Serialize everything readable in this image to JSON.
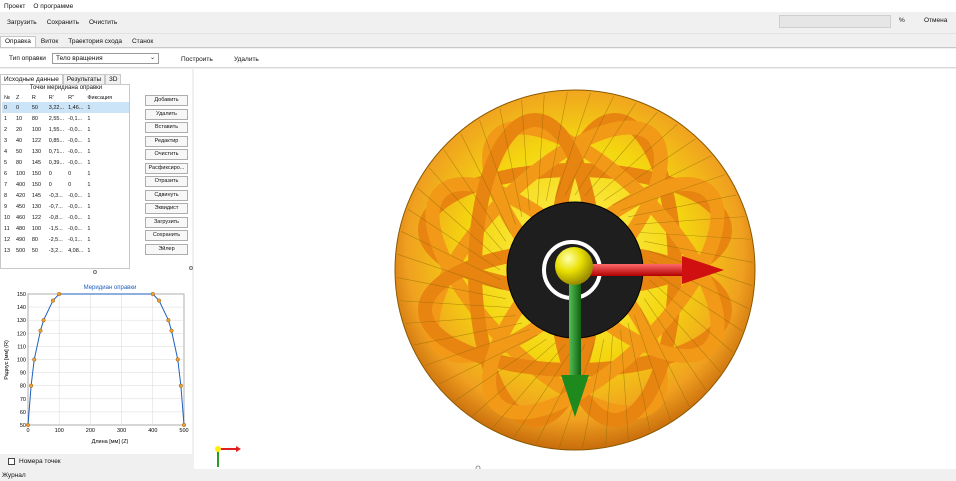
{
  "menu": [
    "Проект",
    "О программе"
  ],
  "toolbar": {
    "load": "Загрузить",
    "save": "Сохранить",
    "clear": "Очистить",
    "percent": "%",
    "cancel": "Отмена"
  },
  "main_tabs": [
    "Оправка",
    "Виток",
    "Траектория схода",
    "Станок"
  ],
  "params": {
    "type_label": "Тип оправки",
    "type_value": "Тело вращения",
    "build": "Построить",
    "delete": "Удалить"
  },
  "sub_tabs": [
    "Исходные данные",
    "Результаты",
    "3D"
  ],
  "points_table": {
    "caption": "Точки меридиана оправки",
    "headers": [
      "№",
      "Z",
      "R",
      "R'",
      "R\"",
      "Фиксация"
    ],
    "rows": [
      [
        "0",
        "0",
        "50",
        "3,22...",
        "1,46...",
        "1"
      ],
      [
        "1",
        "10",
        "80",
        "2,55...",
        "-0,1...",
        "1"
      ],
      [
        "2",
        "20",
        "100",
        "1,55...",
        "-0,0...",
        "1"
      ],
      [
        "3",
        "40",
        "122",
        "0,85...",
        "-0,0...",
        "1"
      ],
      [
        "4",
        "50",
        "130",
        "0,71...",
        "-0,0...",
        "1"
      ],
      [
        "5",
        "80",
        "145",
        "0,39...",
        "-0,0...",
        "1"
      ],
      [
        "6",
        "100",
        "150",
        "0",
        "0",
        "1"
      ],
      [
        "7",
        "400",
        "150",
        "0",
        "0",
        "1"
      ],
      [
        "8",
        "420",
        "145",
        "-0,3...",
        "-0,0...",
        "1"
      ],
      [
        "9",
        "450",
        "130",
        "-0,7...",
        "-0,0...",
        "1"
      ],
      [
        "10",
        "460",
        "122",
        "-0,8...",
        "-0,0...",
        "1"
      ],
      [
        "11",
        "480",
        "100",
        "-1,5...",
        "-0,0...",
        "1"
      ],
      [
        "12",
        "490",
        "80",
        "-2,5...",
        "-0,1...",
        "1"
      ],
      [
        "13",
        "500",
        "50",
        "-3,2...",
        "4,08...",
        "1"
      ]
    ]
  },
  "side_buttons": [
    "Добавить",
    "Удалить",
    "Вставить",
    "Редактир",
    "Очистить",
    "Расфиксиро...",
    "Отразить",
    "Сдвинуть",
    "Эквидист",
    "Загрузить",
    "Сохранить",
    "Эйлер"
  ],
  "chart_data": {
    "type": "line",
    "title": "Меридиан оправки",
    "xlabel": "Длина [мм] (Z)",
    "ylabel": "Радиус [мм] (R)",
    "xlim": [
      0,
      500
    ],
    "ylim": [
      50,
      150
    ],
    "xticks": [
      0,
      100,
      200,
      300,
      400,
      500
    ],
    "yticks": [
      50,
      60,
      70,
      80,
      90,
      100,
      110,
      120,
      130,
      140,
      150
    ],
    "grid": true,
    "series": [
      {
        "x": [
          0,
          10,
          20,
          40,
          50,
          80,
          100,
          400,
          420,
          450,
          460,
          480,
          490,
          500
        ],
        "y": [
          50,
          80,
          100,
          122,
          130,
          145,
          150,
          150,
          145,
          130,
          122,
          100,
          80,
          50
        ],
        "color": "#1f5fbf",
        "marker_color": "#f0a030"
      }
    ]
  },
  "point_numbers_label": "Номера точек",
  "journal": "Журнал",
  "colors": {
    "accent_blue": "#1f5fbf",
    "selection": "#cce4f7",
    "ball_yellow": "#ffee10",
    "ball_orange": "#f08c10",
    "axis_red": "#e02020",
    "axis_green": "#2a9a2a"
  }
}
